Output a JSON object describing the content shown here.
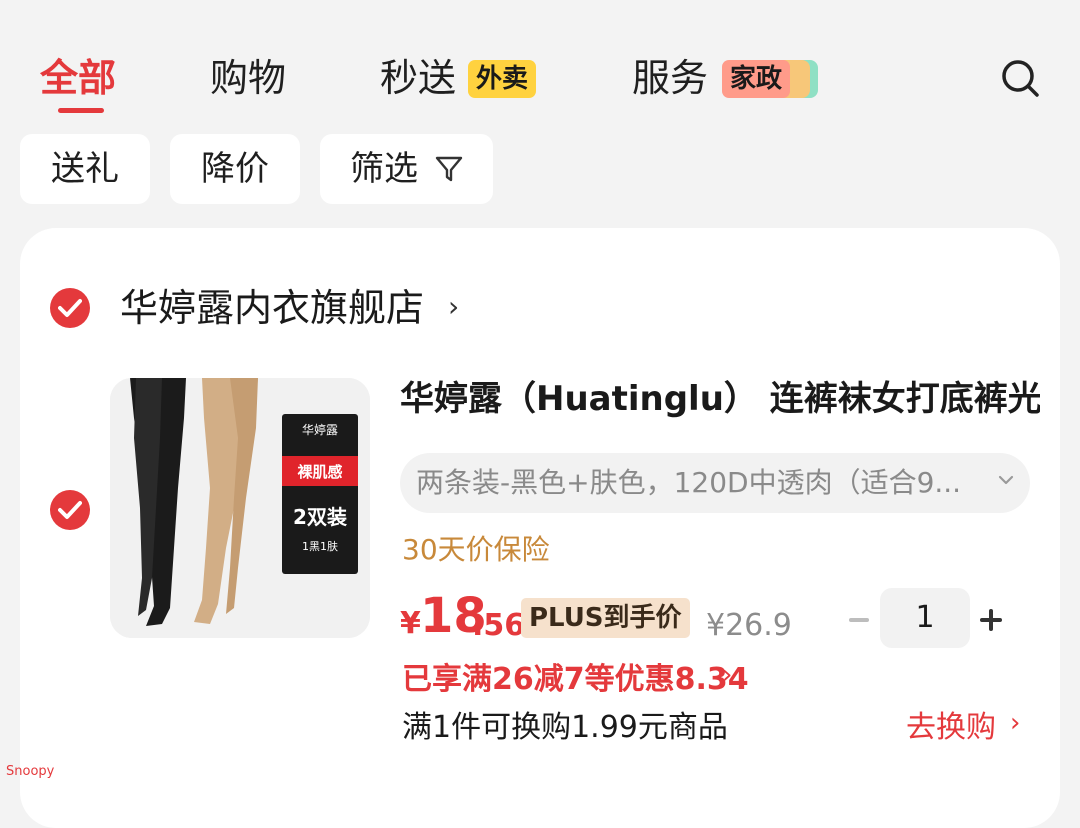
{
  "tabs": [
    {
      "label": "全部"
    },
    {
      "label": "购物"
    },
    {
      "label": "秒送",
      "badge": "外卖"
    },
    {
      "label": "服务",
      "badge": "家政"
    }
  ],
  "filters": {
    "gift": "送礼",
    "price_drop": "降价",
    "filter": "筛选"
  },
  "store": {
    "name": "华婷露内衣旗舰店"
  },
  "product": {
    "image_text": {
      "brand": "华婷露",
      "tag": "裸肌感",
      "pack": "2双装",
      "colors": "1黑1肤"
    },
    "title": "华婷露（Huatinglu） 连裤袜女打底裤光",
    "variant": "两条装-黑色+肤色，120D中透肉（适合9...",
    "insurance": "30天价保险",
    "price_symbol": "¥",
    "price_int": "18",
    "price_dec": ".56",
    "plus_label": "PLUS到手价",
    "original_price": "¥26.9",
    "quantity": "1",
    "promo": "已享满26减7等优惠8.34",
    "exchange": "满1件可换购1.99元商品",
    "exchange_link": "去换购"
  },
  "watermark": "Snoopy",
  "colors": {
    "accent": "#e4393c",
    "background": "#f3f3f3",
    "insurance": "#c8893a"
  }
}
